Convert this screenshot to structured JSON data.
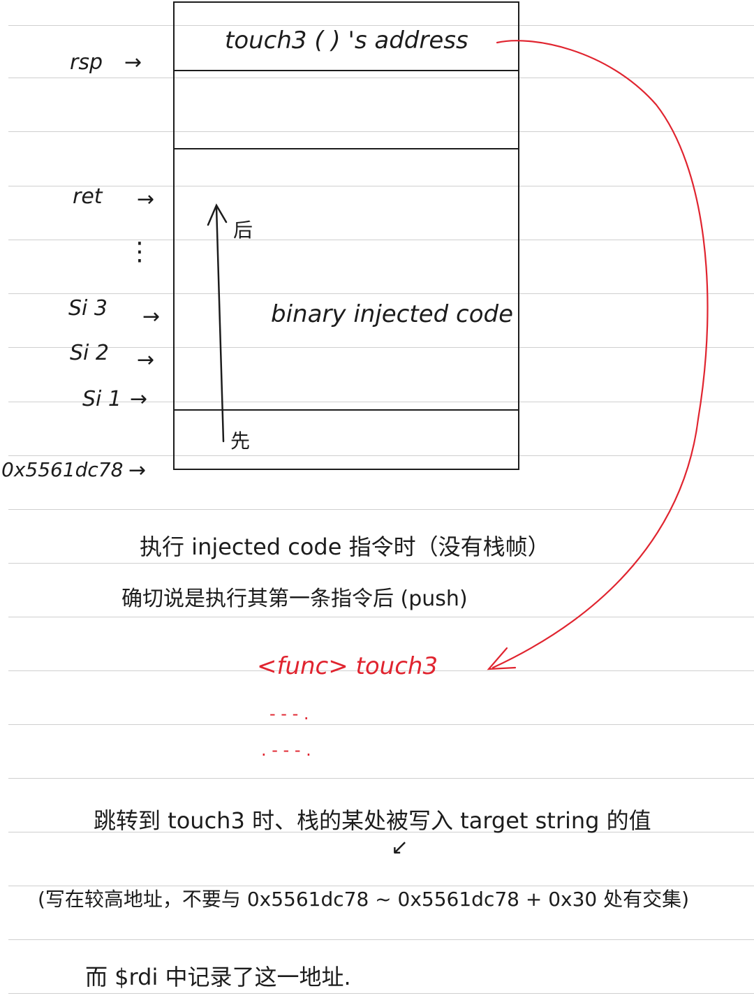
{
  "stack": {
    "top_cell": "touch3 ( ) 's address",
    "body_text": "binary injected code",
    "later_label": "后",
    "earlier_label": "先"
  },
  "labels": {
    "rsp": "rsp",
    "ret": "ret",
    "dots": "⋮",
    "si3": "Si 3",
    "si2": "Si 2",
    "si1": "Si 1",
    "base": "0x5561dc78",
    "arrow": "→"
  },
  "notes": {
    "line1": "执行 injected code 指令时（没有栈帧）",
    "line2": "确切说是执行其第一条指令后 (push)"
  },
  "func": {
    "title": "<func> touch3",
    "dots1": "- - - .",
    "dots2": ". - - - ."
  },
  "bottom": {
    "line1": "跳转到 touch3 时、栈的某处被写入 target string 的值",
    "pointer": "↙",
    "line2": "(写在较高地址，不要与 0x5561dc78 ~ 0x5561dc78 + 0x30 处有交集)",
    "line3": "而 $rdi 中记录了这一地址."
  },
  "colors": {
    "ink": "#1c1c1c",
    "red": "#e0242f",
    "rule": "#cfcfcf"
  }
}
